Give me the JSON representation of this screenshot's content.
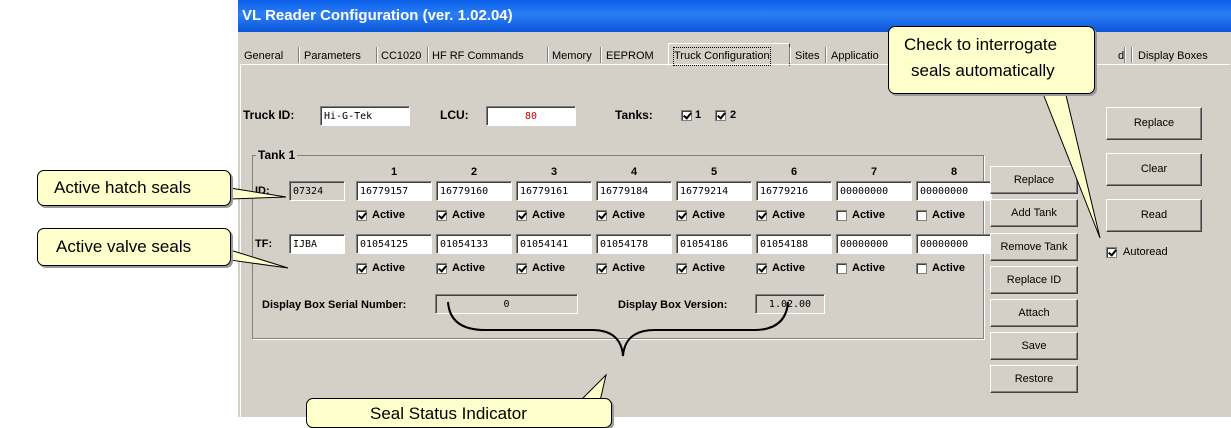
{
  "window": {
    "title": "VL Reader Configuration (ver. 1.02.04)"
  },
  "tabs": [
    "General",
    "Parameters",
    "CC1020",
    "HF RF Commands",
    "Memory",
    "EEPROM",
    "Truck Configuration",
    "Sites",
    "Applicatio",
    "d",
    "Display Boxes"
  ],
  "truck": {
    "truck_id_label": "Truck ID:",
    "truck_id": "Hi-G-Tek",
    "lcu_label": "LCU:",
    "lcu": "80",
    "tanks_label": "Tanks:",
    "tank1": "1",
    "tank2": "2"
  },
  "tank1": {
    "group_label": "Tank 1",
    "columns": [
      "1",
      "2",
      "3",
      "4",
      "5",
      "6",
      "7",
      "8"
    ],
    "id_label": "ID:",
    "id_value": "07324",
    "tf_label": "TF:",
    "tf_value": "IJBA",
    "id_seals": [
      "16779157",
      "16779160",
      "16779161",
      "16779184",
      "16779214",
      "16779216",
      "00000000",
      "00000000"
    ],
    "tf_seals": [
      "01054125",
      "01054133",
      "01054141",
      "01054178",
      "01054186",
      "01054188",
      "00000000",
      "00000000"
    ],
    "active_label": "Active",
    "id_active": [
      true,
      true,
      true,
      true,
      true,
      true,
      false,
      false
    ],
    "tf_active": [
      true,
      true,
      true,
      true,
      true,
      true,
      false,
      false
    ],
    "display_serial_label": "Display Box Serial Number:",
    "display_serial": "0",
    "display_version_label": "Display Box Version:",
    "display_version": "1.02.00"
  },
  "tank_buttons": [
    "Replace",
    "Add Tank",
    "Remove Tank",
    "Replace ID",
    "Attach",
    "Save",
    "Restore"
  ],
  "right_buttons": [
    "Replace",
    "Clear",
    "Read"
  ],
  "autoread": {
    "label": "Autoread",
    "checked": true
  },
  "callouts": {
    "hatch": "Active hatch seals",
    "valve": "Active valve seals",
    "auto_line1": "Check to interrogate",
    "auto_line2": "seals automatically",
    "status": "Seal Status Indicator"
  }
}
